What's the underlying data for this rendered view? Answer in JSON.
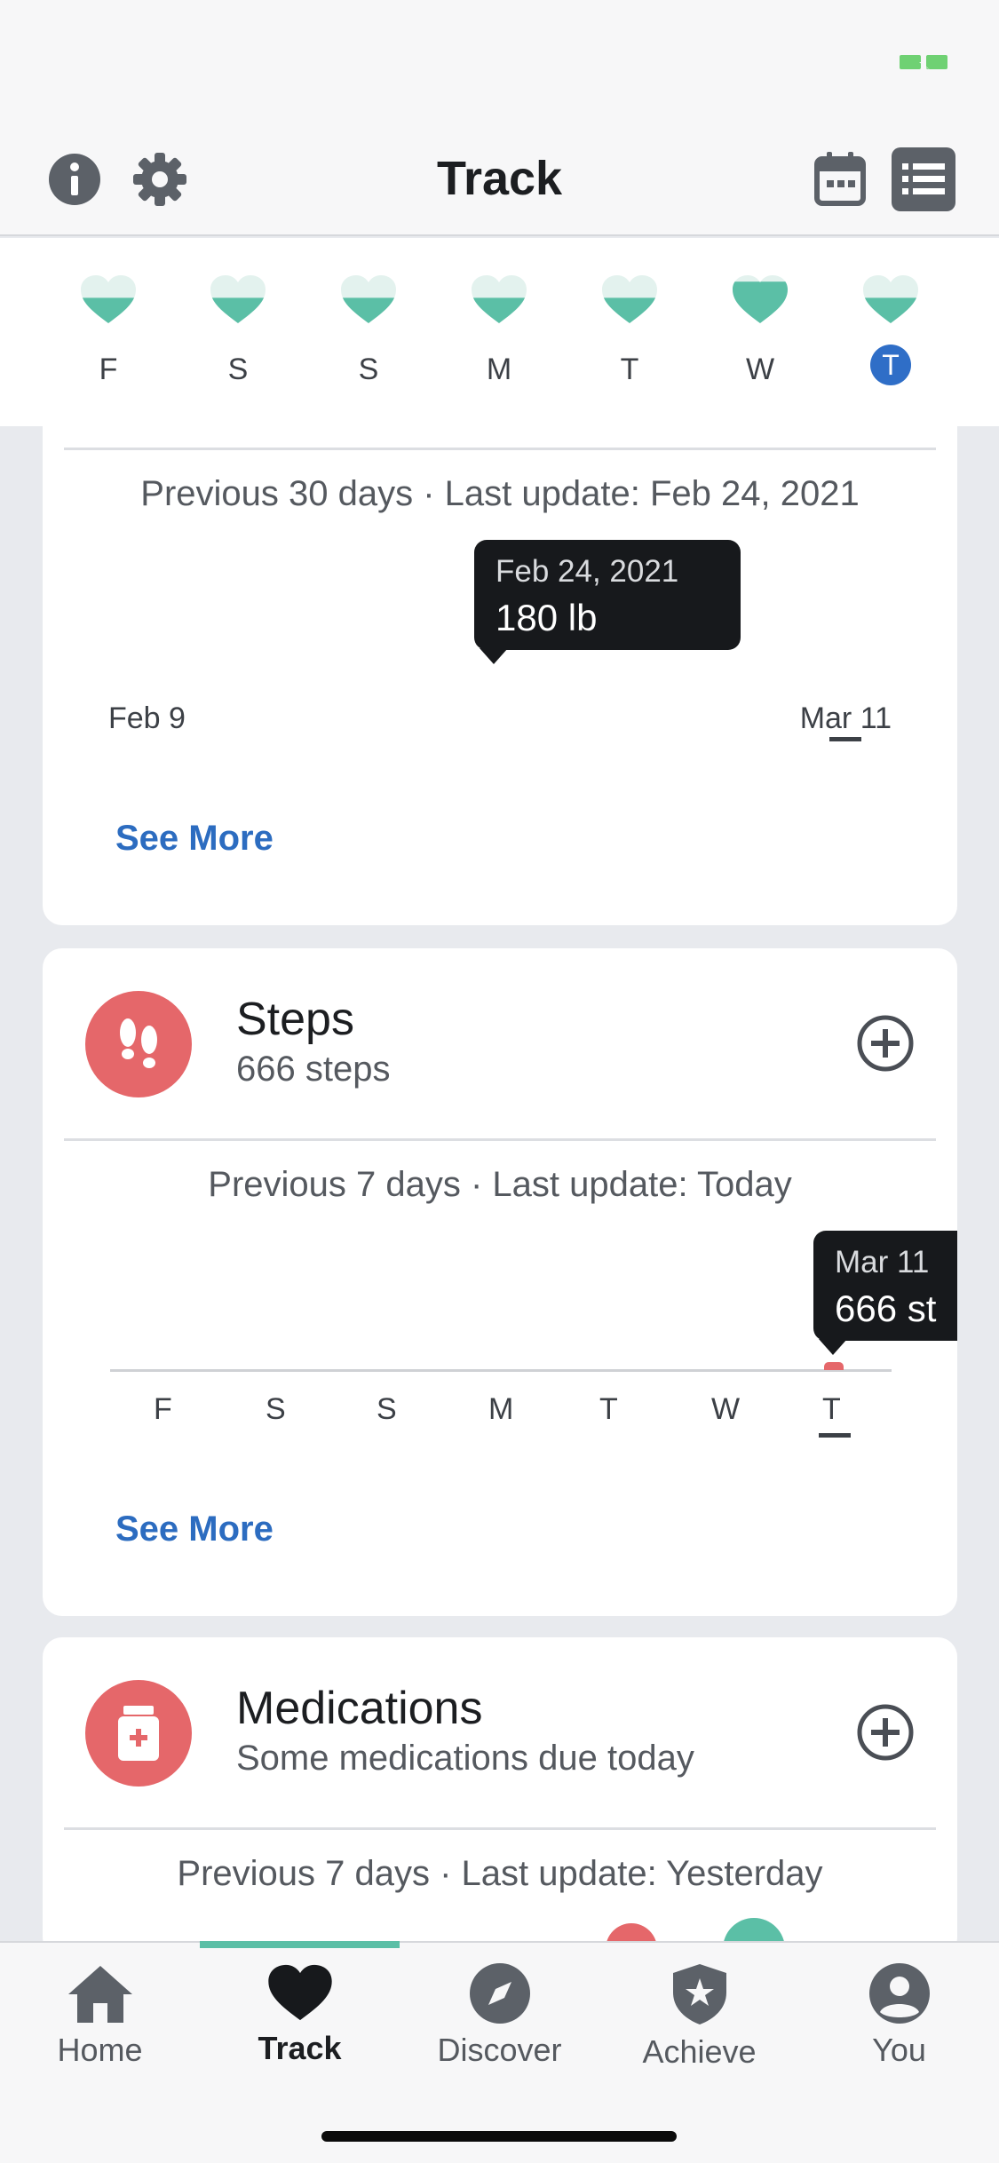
{
  "header": {
    "title": "Track"
  },
  "week": {
    "days": [
      {
        "label": "F",
        "fill": 0.55,
        "today": false
      },
      {
        "label": "S",
        "fill": 0.55,
        "today": false
      },
      {
        "label": "S",
        "fill": 0.55,
        "today": false
      },
      {
        "label": "M",
        "fill": 0.55,
        "today": false
      },
      {
        "label": "T",
        "fill": 0.55,
        "today": false
      },
      {
        "label": "W",
        "fill": 0.9,
        "today": false
      },
      {
        "label": "T",
        "fill": 0.55,
        "today": true
      }
    ]
  },
  "weight_card": {
    "subtitle": "Previous 30 days · Last update: Feb 24, 2021",
    "tooltip_date": "Feb 24, 2021",
    "tooltip_value": "180 lb",
    "axis_start": "Feb 9",
    "axis_end": "Mar 11",
    "see_more": "See More"
  },
  "steps_card": {
    "title": "Steps",
    "value": "666 steps",
    "subtitle": "Previous 7 days · Last update: Today",
    "tooltip_date": "Mar 11",
    "tooltip_value": "666 st",
    "days": [
      "F",
      "S",
      "S",
      "M",
      "T",
      "W",
      "T"
    ],
    "see_more": "See More"
  },
  "medications_card": {
    "title": "Medications",
    "status": "Some medications due today",
    "subtitle": "Previous 7 days · Last update: Yesterday"
  },
  "tabs": [
    {
      "label": "Home",
      "icon": "home-icon",
      "active": false
    },
    {
      "label": "Track",
      "icon": "heart-icon",
      "active": true
    },
    {
      "label": "Discover",
      "icon": "compass-icon",
      "active": false
    },
    {
      "label": "Achieve",
      "icon": "shield-star-icon",
      "active": false
    },
    {
      "label": "You",
      "icon": "person-icon",
      "active": false
    }
  ],
  "colors": {
    "accent_green": "#5bbfa6",
    "accent_red": "#e5676a",
    "link_blue": "#2c6cc0",
    "today_blue": "#2f6ec7"
  }
}
